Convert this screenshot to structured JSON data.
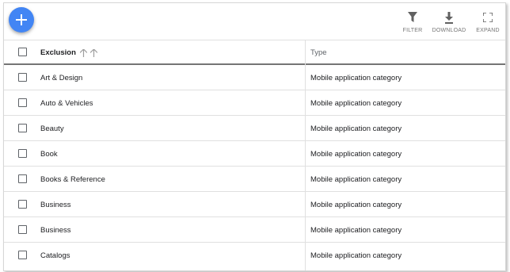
{
  "toolbar": {
    "filter_label": "FILTER",
    "download_label": "DOWNLOAD",
    "expand_label": "EXPAND"
  },
  "table": {
    "columns": [
      "Exclusion",
      "Type"
    ],
    "rows": [
      {
        "exclusion": "Art & Design",
        "type": "Mobile application category"
      },
      {
        "exclusion": "Auto & Vehicles",
        "type": "Mobile application category"
      },
      {
        "exclusion": "Beauty",
        "type": "Mobile application category"
      },
      {
        "exclusion": "Book",
        "type": "Mobile application category"
      },
      {
        "exclusion": "Books & Reference",
        "type": "Mobile application category"
      },
      {
        "exclusion": "Business",
        "type": "Mobile application category"
      },
      {
        "exclusion": "Business",
        "type": "Mobile application category"
      },
      {
        "exclusion": "Catalogs",
        "type": "Mobile application category"
      }
    ]
  },
  "colors": {
    "accent": "#4285f4",
    "header_rule": "#757575",
    "row_border": "#e0e0e0"
  },
  "icons": [
    "add-icon",
    "filter-icon",
    "download-icon",
    "expand-icon",
    "sort-arrow-icon"
  ]
}
